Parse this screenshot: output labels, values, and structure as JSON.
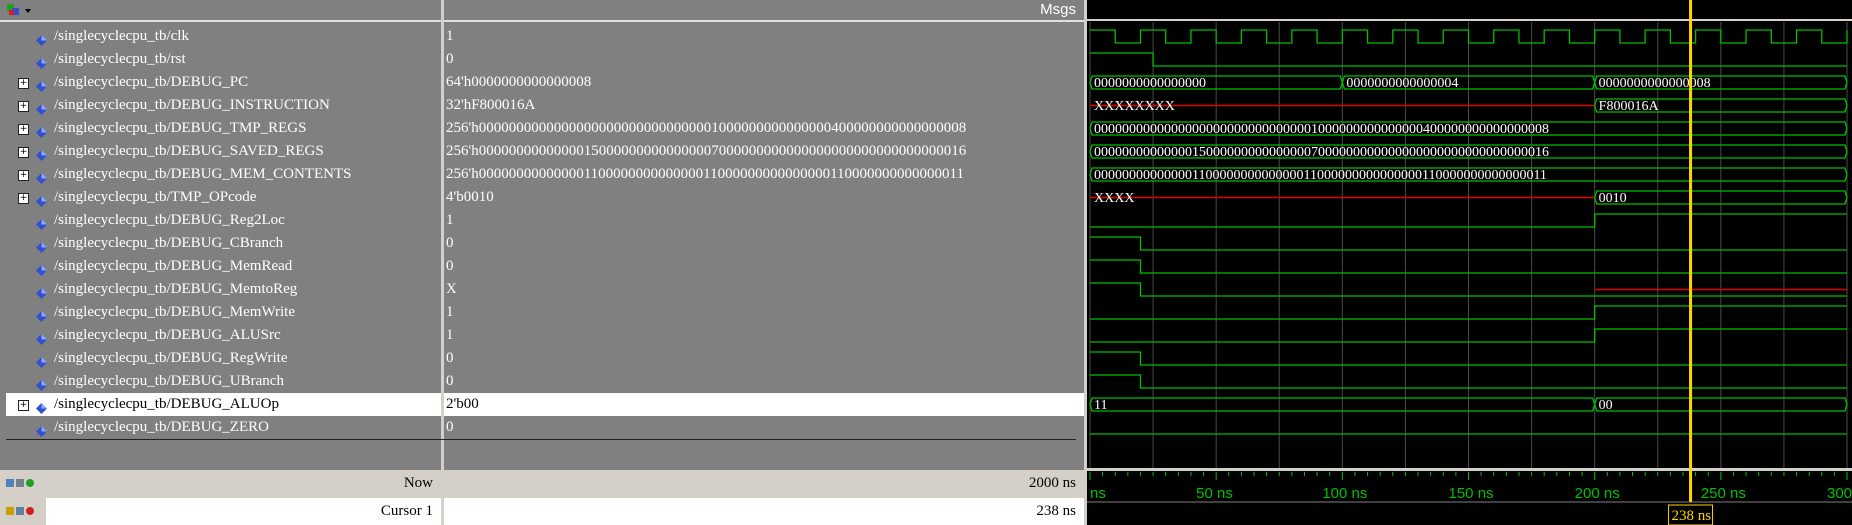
{
  "header": {
    "msgs_label": "Msgs"
  },
  "signals": [
    {
      "name": "/singlecyclecpu_tb/clk",
      "value": "1",
      "expandable": false
    },
    {
      "name": "/singlecyclecpu_tb/rst",
      "value": "0",
      "expandable": false
    },
    {
      "name": "/singlecyclecpu_tb/DEBUG_PC",
      "value": "64'h0000000000000008",
      "expandable": true
    },
    {
      "name": "/singlecyclecpu_tb/DEBUG_INSTRUCTION",
      "value": "32'hF800016A",
      "expandable": true
    },
    {
      "name": "/singlecyclecpu_tb/DEBUG_TMP_REGS",
      "value": "256'h00000000000000000000000000000001000000000000000400000000000000008",
      "expandable": true
    },
    {
      "name": "/singlecyclecpu_tb/DEBUG_SAVED_REGS",
      "value": "256'h00000000000000150000000000000007000000000000000000000000000000016",
      "expandable": true
    },
    {
      "name": "/singlecyclecpu_tb/DEBUG_MEM_CONTENTS",
      "value": "256'h00000000000000110000000000000011000000000000000110000000000000011",
      "expandable": true
    },
    {
      "name": "/singlecyclecpu_tb/TMP_OPcode",
      "value": "4'b0010",
      "expandable": true
    },
    {
      "name": "/singlecyclecpu_tb/DEBUG_Reg2Loc",
      "value": "1",
      "expandable": false
    },
    {
      "name": "/singlecyclecpu_tb/DEBUG_CBranch",
      "value": "0",
      "expandable": false
    },
    {
      "name": "/singlecyclecpu_tb/DEBUG_MemRead",
      "value": "0",
      "expandable": false
    },
    {
      "name": "/singlecyclecpu_tb/DEBUG_MemtoReg",
      "value": "X",
      "expandable": false
    },
    {
      "name": "/singlecyclecpu_tb/DEBUG_MemWrite",
      "value": "1",
      "expandable": false
    },
    {
      "name": "/singlecyclecpu_tb/DEBUG_ALUSrc",
      "value": "1",
      "expandable": false
    },
    {
      "name": "/singlecyclecpu_tb/DEBUG_RegWrite",
      "value": "0",
      "expandable": false
    },
    {
      "name": "/singlecyclecpu_tb/DEBUG_UBranch",
      "value": "0",
      "expandable": false
    },
    {
      "name": "/singlecyclecpu_tb/DEBUG_ALUOp",
      "value": "2'b00",
      "expandable": true,
      "selected": true
    },
    {
      "name": "/singlecyclecpu_tb/DEBUG_ZERO",
      "value": "0",
      "expandable": false
    }
  ],
  "waveforms": {
    "time_range_ns": [
      0,
      300
    ],
    "pc_segments": [
      "0000000000000000",
      "0000000000000004",
      "0000000000000008"
    ],
    "instruction_segments": [
      "XXXXXXXX",
      "F800016A"
    ],
    "tmp_regs_value": "00000000000000000000000000000001000000000000000400000000000000008",
    "saved_regs_value": "00000000000000150000000000000007000000000000000000000000000000016",
    "mem_contents_value": "00000000000000110000000000000011000000000000000110000000000000011",
    "opcode_segments": [
      "XXXX",
      "0010"
    ],
    "aluop_segments": [
      "11",
      "00"
    ]
  },
  "footer": {
    "now_label": "Now",
    "now_value": "2000 ns",
    "cursor_label": "Cursor 1",
    "cursor_value": "238 ns",
    "cursor_badge": "238 ns"
  },
  "timeline": {
    "tick_labels": [
      "ns",
      "50 ns",
      "100 ns",
      "150 ns",
      "200 ns",
      "250 ns",
      "300"
    ],
    "cursor_time_ns": 238
  },
  "colors": {
    "wave_green": "#00c000",
    "undefined_red": "#e00000",
    "cursor_yellow": "#ffd400",
    "pane_grey": "#808080",
    "diamond_blue": "#3050d0"
  }
}
